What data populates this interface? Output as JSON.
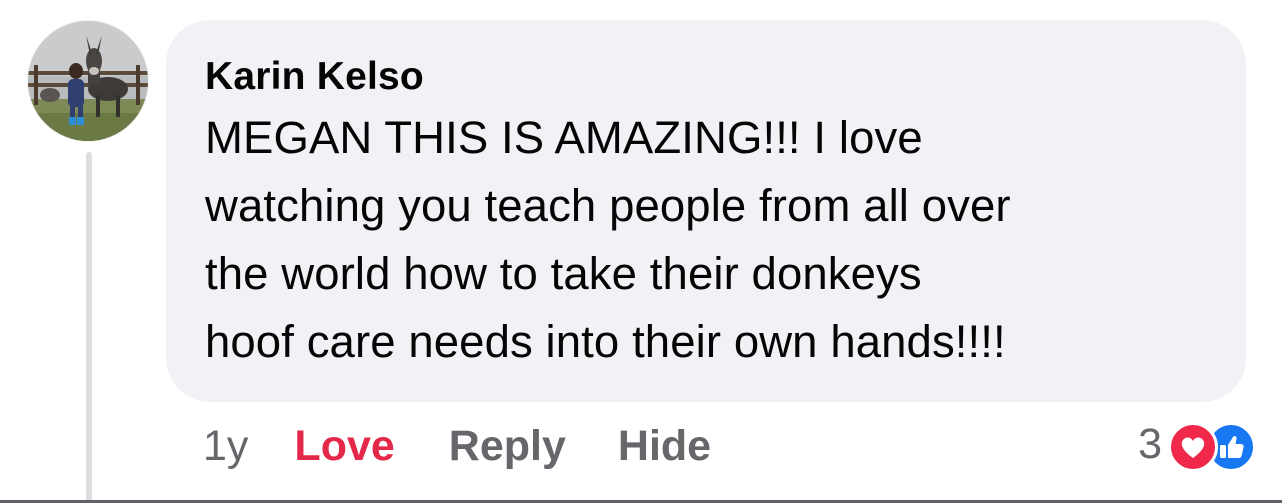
{
  "comment": {
    "author": "Karin Kelso",
    "lines": [
      "MEGAN THIS IS AMAZING!!! I love",
      "watching you teach people from all over",
      "the world how to take their donkeys",
      "hoof care needs into their own hands!!!!"
    ]
  },
  "actions": {
    "timestamp": "1y",
    "love_label": "Love",
    "reply_label": "Reply",
    "hide_label": "Hide"
  },
  "reactions": {
    "count": "3",
    "types": [
      "love-icon",
      "like-icon"
    ]
  },
  "colors": {
    "bubble_bg": "#f0f2f5",
    "love_accent": "#e4284a",
    "secondary_text": "#65676b",
    "like_blue": "#1877f2"
  }
}
